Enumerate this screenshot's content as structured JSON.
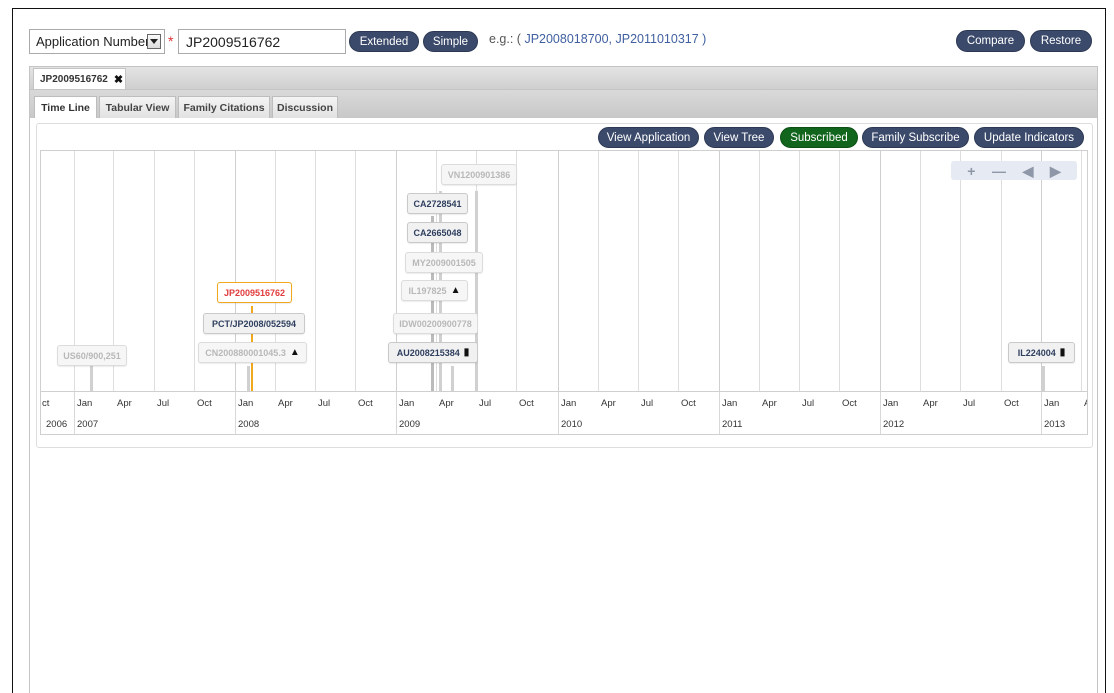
{
  "search": {
    "type_label": "Application Number",
    "required_mark": "*",
    "number_value": "JP2009516762",
    "extended_label": "Extended",
    "simple_label": "Simple",
    "example_prefix": "e.g.: ( ",
    "example_links": "JP2008018700, JP2011010317",
    "example_suffix": " )"
  },
  "actions": {
    "compare_label": "Compare",
    "restore_label": "Restore"
  },
  "doc_tab": {
    "label": "JP2009516762",
    "close_icon": "✖"
  },
  "view_tabs": [
    "Time Line",
    "Tabular View",
    "Family Citations",
    "Discussion"
  ],
  "toolbar": {
    "view_application": "View Application",
    "view_tree": "View Tree",
    "subscribed": "Subscribed",
    "family_subscribe": "Family Subscribe",
    "update_indicators": "Update Indicators"
  },
  "zoom": {
    "plus": "+",
    "minus": "—",
    "left": "◀",
    "right": "▶"
  },
  "timeline": {
    "months": [
      "ct",
      "Jan",
      "Apr",
      "Jul",
      "Oct",
      "Jan",
      "Apr",
      "Jul",
      "Oct",
      "Jan",
      "Apr",
      "Jul",
      "Oct",
      "Jan",
      "Apr",
      "Jul",
      "Oct",
      "Jan",
      "Apr",
      "Jul",
      "Oct",
      "Jan",
      "Apr",
      "Jul",
      "Oct",
      "Jan",
      "A"
    ],
    "years": [
      "2006",
      "2007",
      "2008",
      "2009",
      "2010",
      "2011",
      "2012",
      "2013"
    ],
    "events": [
      {
        "label": "VN1200901386",
        "icon": ""
      },
      {
        "label": "CA2728541",
        "icon": ""
      },
      {
        "label": "CA2665048",
        "icon": ""
      },
      {
        "label": "MY2009001505",
        "icon": ""
      },
      {
        "label": "IL197825",
        "icon": "warning-icon"
      },
      {
        "label": "IDW00200900778",
        "icon": ""
      },
      {
        "label": "AU2008215384",
        "icon": "book-icon"
      },
      {
        "label": "JP2009516762",
        "icon": ""
      },
      {
        "label": "PCT/JP2008/052594",
        "icon": ""
      },
      {
        "label": "CN200880001045.3",
        "icon": "warning-icon"
      },
      {
        "label": "US60/900,251",
        "icon": ""
      },
      {
        "label": "IL224004",
        "icon": "book-icon"
      }
    ]
  },
  "colors": {
    "pill": "#3b4a6b",
    "subscribed": "#11651c",
    "active_event": "#e23b3b",
    "active_border": "#f2a81d",
    "link": "#3f5fa0"
  }
}
